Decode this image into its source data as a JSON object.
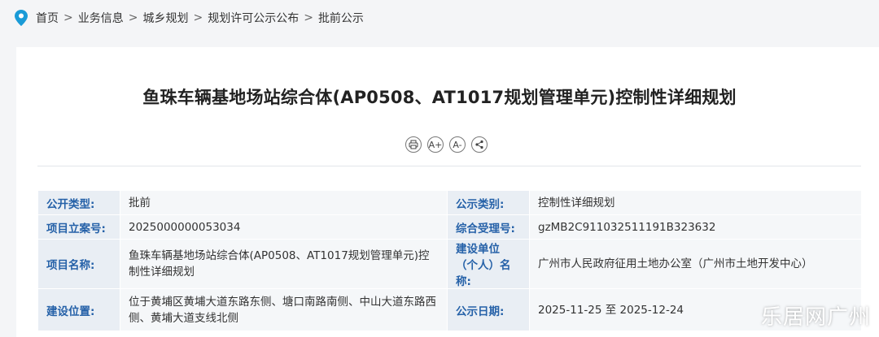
{
  "breadcrumb": {
    "items": [
      "首页",
      "业务信息",
      "城乡规划",
      "规划许可公示公布",
      "批前公示"
    ],
    "separator": ">"
  },
  "article": {
    "title": "鱼珠车辆基地场站综合体(AP0508、AT1017规划管理单元)控制性详细规划",
    "tools": {
      "font_increase": "A+",
      "font_decrease": "A-"
    }
  },
  "info_table": {
    "rows": [
      {
        "label1": "公开类型:",
        "value1": "批前",
        "label2": "公示类别:",
        "value2": "控制性详细规划"
      },
      {
        "label1": "项目立案号:",
        "value1": "2025000000053034",
        "label2": "综合受理号:",
        "value2": "gzMB2C911032511191B323632"
      },
      {
        "label1": "项目名称:",
        "value1": "鱼珠车辆基地场站综合体(AP0508、AT1017规划管理单元)控制性详细规划",
        "label2": "建设单位（个人）名称:",
        "value2": "广州市人民政府征用土地办公室（广州市土地开发中心）"
      },
      {
        "label1": "建设位置:",
        "value1": "位于黄埔区黄埔大道东路东侧、塘口南路南侧、中山大道东路西侧、黄埔大道支线北侧",
        "label2": "公示日期:",
        "value2": "2025-11-25 至 2025-12-24"
      }
    ]
  },
  "watermark": "乐居网广州",
  "colors": {
    "label_text": "#2561a8",
    "label_bg": "#e9eef4",
    "value_bg": "#f5f7f9",
    "pin_icon": "#1a9bd7"
  }
}
